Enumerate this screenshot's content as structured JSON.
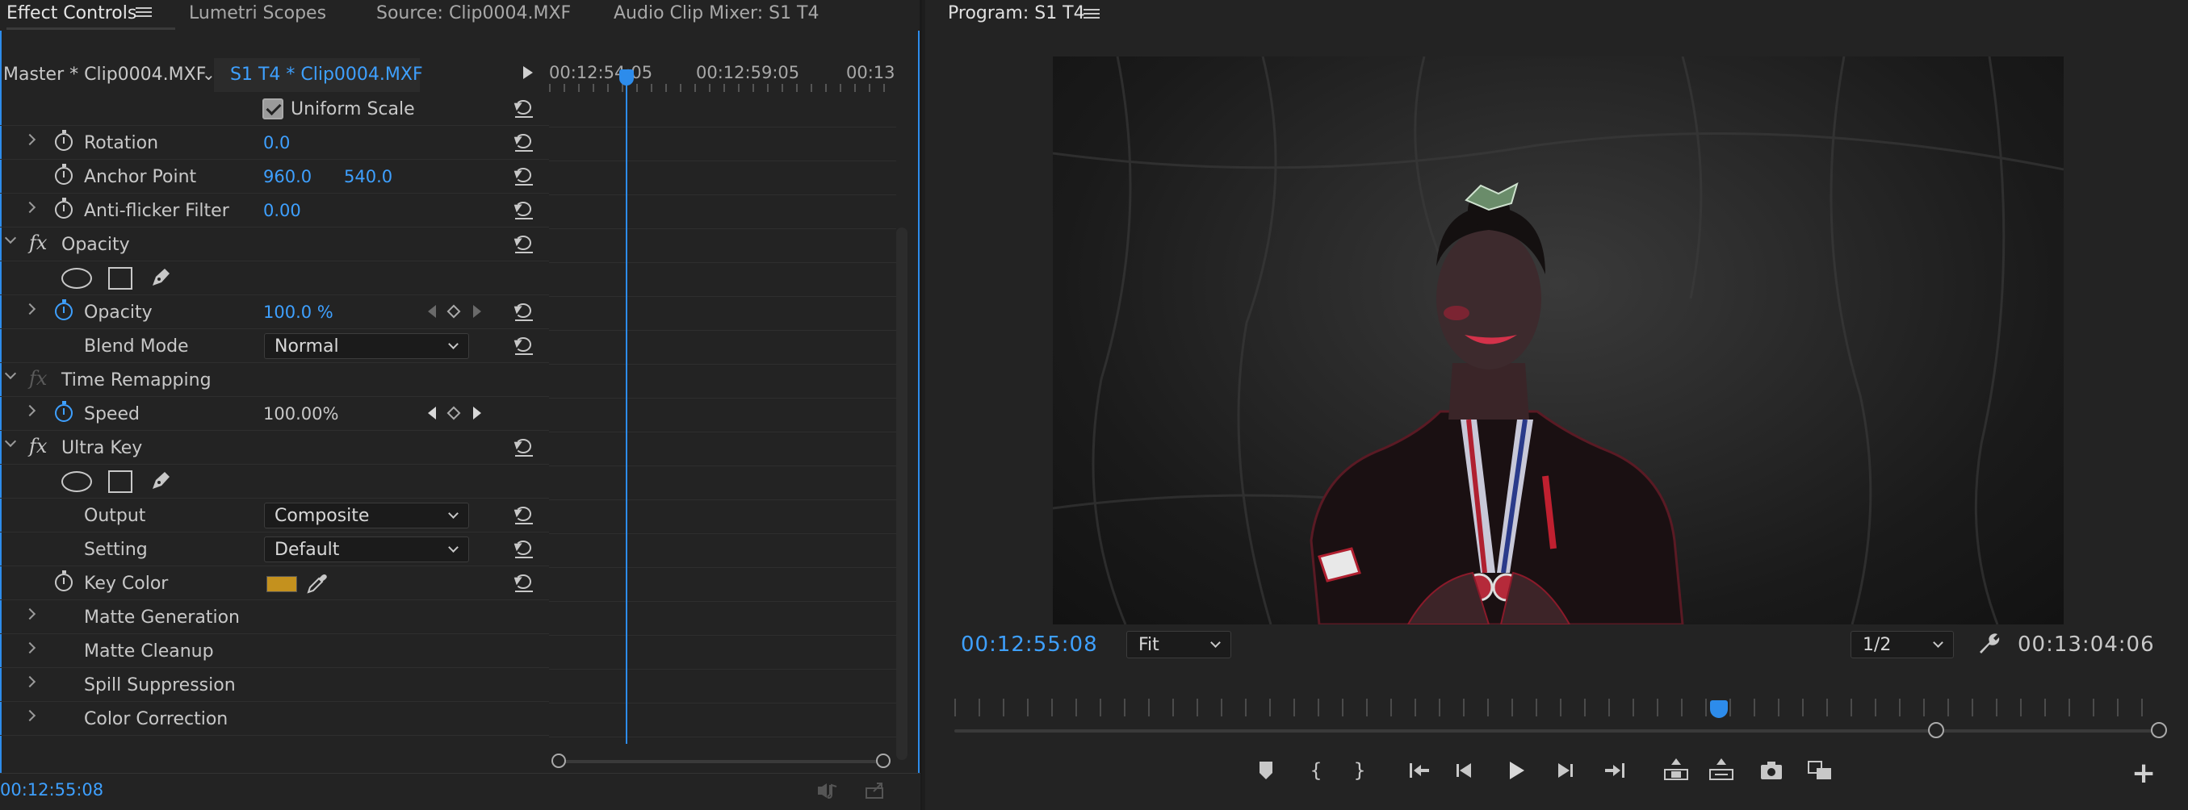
{
  "left_panel": {
    "tabs": [
      {
        "label": "Effect Controls",
        "active": true
      },
      {
        "label": "Lumetri Scopes",
        "active": false
      },
      {
        "label": "Source: Clip0004.MXF",
        "active": false
      },
      {
        "label": "Audio Clip Mixer: S1 T4",
        "active": false
      }
    ],
    "master_clip": "Master * Clip0004.MXF",
    "sequence_clip": "S1 T4 * Clip0004.MXF",
    "properties": {
      "uniform_scale": "Uniform Scale",
      "rotation": {
        "label": "Rotation",
        "value": "0.0"
      },
      "anchor_point": {
        "label": "Anchor Point",
        "x": "960.0",
        "y": "540.0"
      },
      "anti_flicker": {
        "label": "Anti-flicker Filter",
        "value": "0.00"
      },
      "opacity_group": "Opacity",
      "opacity": {
        "label": "Opacity",
        "value": "100.0 %"
      },
      "blend_mode": {
        "label": "Blend Mode",
        "value": "Normal"
      },
      "time_remap_group": "Time Remapping",
      "speed": {
        "label": "Speed",
        "value": "100.00%"
      },
      "ultra_key_group": "Ultra Key",
      "output": {
        "label": "Output",
        "value": "Composite"
      },
      "setting": {
        "label": "Setting",
        "value": "Default"
      },
      "key_color": {
        "label": "Key Color",
        "color": "#c4911e"
      },
      "matte_generation": "Matte Generation",
      "matte_cleanup": "Matte Cleanup",
      "spill_suppression": "Spill Suppression",
      "color_correction": "Color Correction"
    },
    "timeline": {
      "times": [
        "00:12:54:05",
        "00:12:59:05",
        "00:13"
      ]
    },
    "current_time": "00:12:55:08"
  },
  "program_monitor": {
    "title": "Program: S1 T4",
    "current_time": "00:12:55:08",
    "zoom": "Fit",
    "resolution": "1/2",
    "duration": "00:13:04:06"
  },
  "colors": {
    "accent": "#2d8ceb",
    "value_blue": "#3ea0ff",
    "panel_bg": "#232323"
  }
}
